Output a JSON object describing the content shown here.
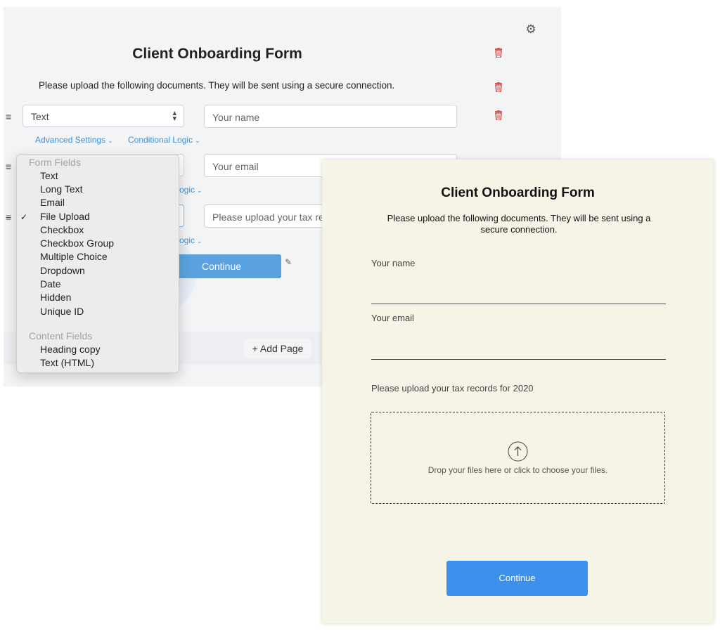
{
  "editor": {
    "title": "Client Onboarding Form",
    "description": "Please upload the following documents. They will be sent using a secure connection.",
    "fields": [
      {
        "type": "Text",
        "placeholder": "Your name"
      },
      {
        "type": "",
        "placeholder": "Your email"
      },
      {
        "type": "",
        "placeholder": "Please upload your tax re"
      }
    ],
    "advanced_settings_label": "Advanced Settings",
    "conditional_logic_label": "Conditional Logic",
    "logic_partial_label": "ogic",
    "continue_label": "Continue",
    "add_page_label": "+ Add Page",
    "accent_color": "#3d8fd6",
    "delete_color": "#d9534f"
  },
  "dropdown": {
    "form_fields_header": "Form Fields",
    "form_fields": [
      "Text",
      "Long Text",
      "Email",
      "File Upload",
      "Checkbox",
      "Checkbox Group",
      "Multiple Choice",
      "Dropdown",
      "Date",
      "Hidden",
      "Unique ID"
    ],
    "selected": "File Upload",
    "check_mark": "✓",
    "content_fields_header": "Content Fields",
    "content_fields": [
      "Heading copy",
      "Text (HTML)"
    ]
  },
  "preview": {
    "title": "Client Onboarding Form",
    "description": "Please upload the following documents. They will be sent using a secure connection.",
    "name_label": "Your name",
    "email_label": "Your email",
    "upload_label": "Please upload your tax records for 2020",
    "drop_text": "Drop your files here or click to choose your files.",
    "continue_label": "Continue",
    "background_color": "#f6f4e7",
    "button_color": "#3d91ec"
  }
}
